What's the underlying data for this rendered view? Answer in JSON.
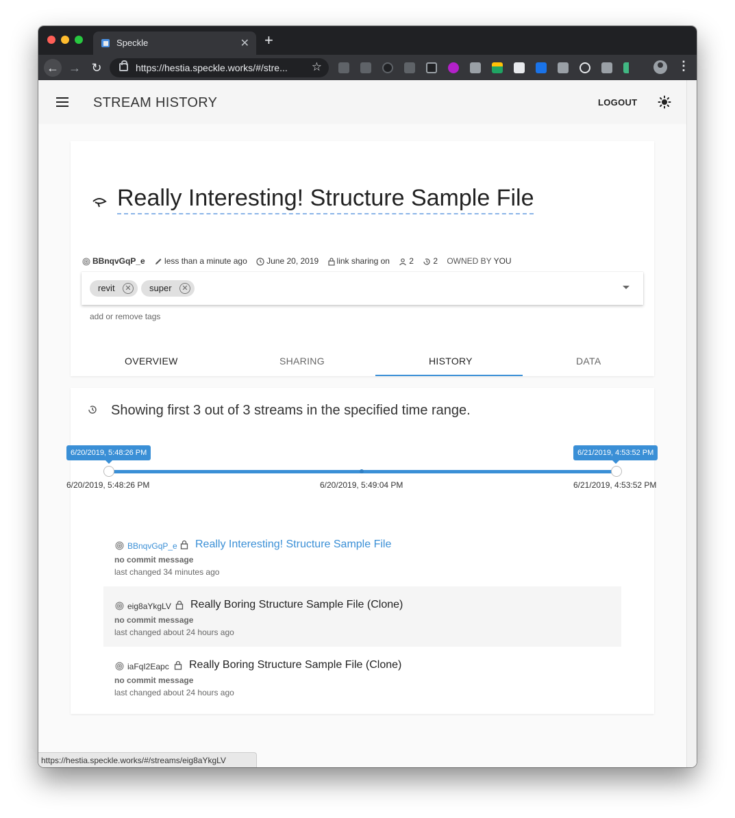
{
  "browser": {
    "tab_title": "Speckle",
    "tab_close": "✕",
    "new_tab": "+",
    "url": "https://hestia.speckle.works/#/stre...",
    "status_url": "https://hestia.speckle.works/#/streams/eig8aYkgLV"
  },
  "appbar": {
    "title": "STREAM HISTORY",
    "logout_label": "LOGOUT"
  },
  "stream": {
    "title": "Really Interesting! Structure Sample File",
    "id": "BBnqvGqP_e",
    "edited": "less than a minute ago",
    "date": "June 20, 2019",
    "sharing": "link sharing on",
    "collaborators": "2",
    "history_count": "2",
    "owned_by": "OWNED BY",
    "owner": "YOU",
    "tags": [
      "revit",
      "super"
    ],
    "tags_hint": "add or remove tags"
  },
  "tabs": [
    {
      "label": "OVERVIEW",
      "active": false
    },
    {
      "label": "SHARING",
      "active": false
    },
    {
      "label": "HISTORY",
      "active": true
    },
    {
      "label": "DATA",
      "active": false
    }
  ],
  "history": {
    "summary": "Showing first 3 out of 3 streams in the specified time range.",
    "range_start": "6/20/2019, 5:48:26 PM",
    "range_end": "6/21/2019, 4:53:52 PM",
    "tick_labels": [
      "6/20/2019, 5:48:26 PM",
      "6/20/2019, 5:49:04 PM",
      "6/21/2019, 4:53:52 PM"
    ],
    "streams": [
      {
        "id": "BBnqvGqP_e",
        "title": "Really Interesting! Structure Sample File",
        "message": "no commit message",
        "changed": "last changed 34 minutes ago"
      },
      {
        "id": "eig8aYkgLV",
        "title": "Really Boring Structure Sample File (Clone)",
        "message": "no commit message",
        "changed": "last changed about 24 hours ago"
      },
      {
        "id": "iaFqI2Eapc",
        "title": "Really Boring Structure Sample File (Clone)",
        "message": "no commit message",
        "changed": "last changed about 24 hours ago"
      }
    ]
  },
  "colors": {
    "accent": "#3a8fd6",
    "chrome_dark": "#202124",
    "card_bg": "#ffffff"
  }
}
